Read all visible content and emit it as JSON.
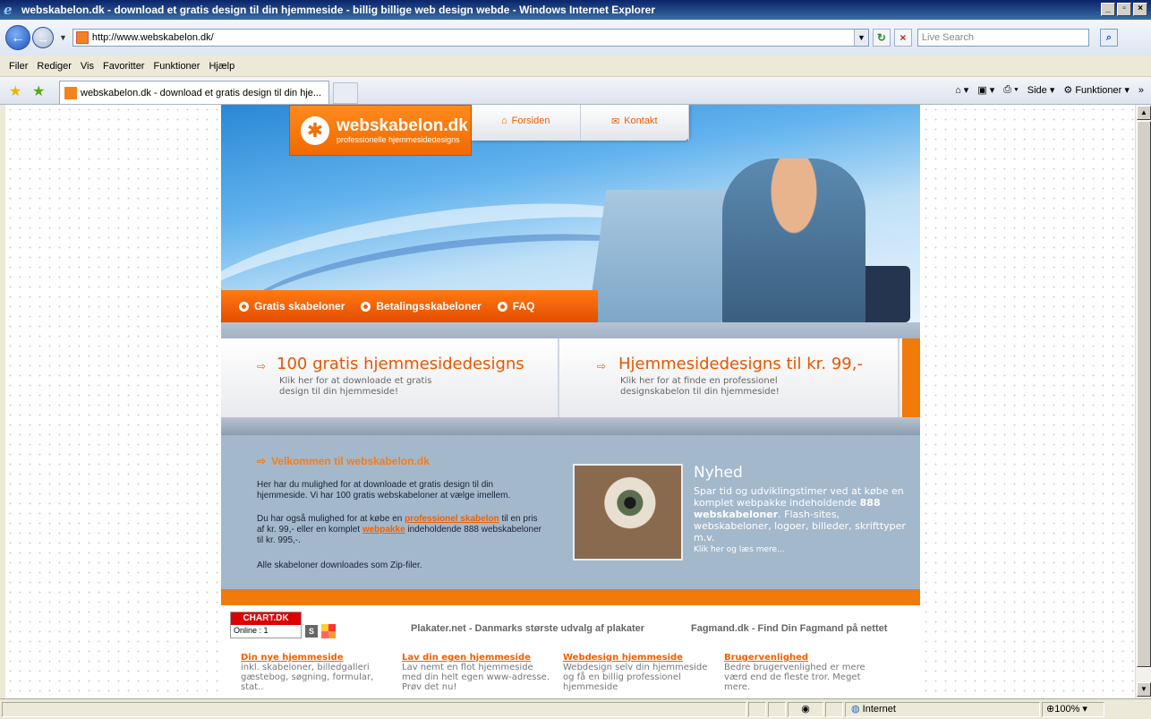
{
  "window": {
    "title": "webskabelon.dk - download et gratis design til din hjemmeside - billig billige web design webde - Windows Internet Explorer"
  },
  "address": {
    "url": "http://www.webskabelon.dk/",
    "search_placeholder": "Live Search"
  },
  "menu": [
    "Filer",
    "Rediger",
    "Vis",
    "Favoritter",
    "Funktioner",
    "Hjælp"
  ],
  "tab": {
    "title": "webskabelon.dk - download et gratis design til din hje..."
  },
  "cmdbar": {
    "page": "Side",
    "tools": "Funktioner"
  },
  "site": {
    "logo": {
      "name": "webskabelon.dk",
      "tagline": "professionelle hjemmesidedesigns"
    },
    "topnav": [
      "Forsiden",
      "Kontakt"
    ],
    "subnav": [
      "Gratis skabeloner",
      "Betalingsskabeloner",
      "FAQ"
    ],
    "features": [
      {
        "title": "100 gratis hjemmesidedesigns",
        "desc1": "Klik her for at downloade et gratis",
        "desc2": "design til din hjemmeside!"
      },
      {
        "title": "Hjemmesidedesigns til kr. 99,-",
        "desc1": "Klik her for at finde en professionel",
        "desc2": "designskabelon til din hjemmeside!"
      }
    ],
    "welcome": {
      "title": "Velkommen til webskabelon.dk",
      "p1": "Her har du mulighed for at downloade et gratis design til din hjemmeside. Vi har 100 gratis webskabeloner at vælge imellem.",
      "p2a": "Du har også mulighed for at købe en",
      "p2link1": "professionel skabelon",
      "p2b": "til en pris af kr. 99,- eller en komplet",
      "p2link2": "webpakke",
      "p2c": "indeholdende 888 webskabeloner til kr. 995,-.",
      "p3": "Alle skabeloner downloades som Zip-filer."
    },
    "nyhed": {
      "title": "Nyhed",
      "text1": "Spar tid og udviklingstimer ved at købe en komplet webpakke indeholdende",
      "bold": "888 webskabeloner",
      "text2": ". Flash-sites, webskabeloner, logoer, billeder, skrifttyper m.v.",
      "link": "Klik her og læs mere..."
    },
    "footer": {
      "chart_label": "CHART.DK",
      "online": "Online : 1",
      "s_label": "S",
      "link1": "Plakater.net - Danmarks største udvalg af plakater",
      "link2": "Fagmand.dk - Find Din Fagmand på nettet",
      "cols": [
        {
          "h": "Din nye hjemmeside",
          "t": "inkl. skabeloner, billedgalleri gæstebog, søgning, formular, stat.."
        },
        {
          "h": "Lav din egen hjemmeside",
          "t": "Lav nemt en flot hjemmeside med din helt egen www-adresse. Prøv det nu!"
        },
        {
          "h": "Webdesign hjemmeside",
          "t": "Webdesign selv din hjemmeside og få en billig professionel hjemmeside"
        },
        {
          "h": "Brugervenlighed",
          "t": "Bedre brugervenlighed er mere værd end de fleste tror. Meget mere."
        }
      ]
    }
  },
  "status": {
    "zone": "Internet",
    "zoom": "100%"
  }
}
